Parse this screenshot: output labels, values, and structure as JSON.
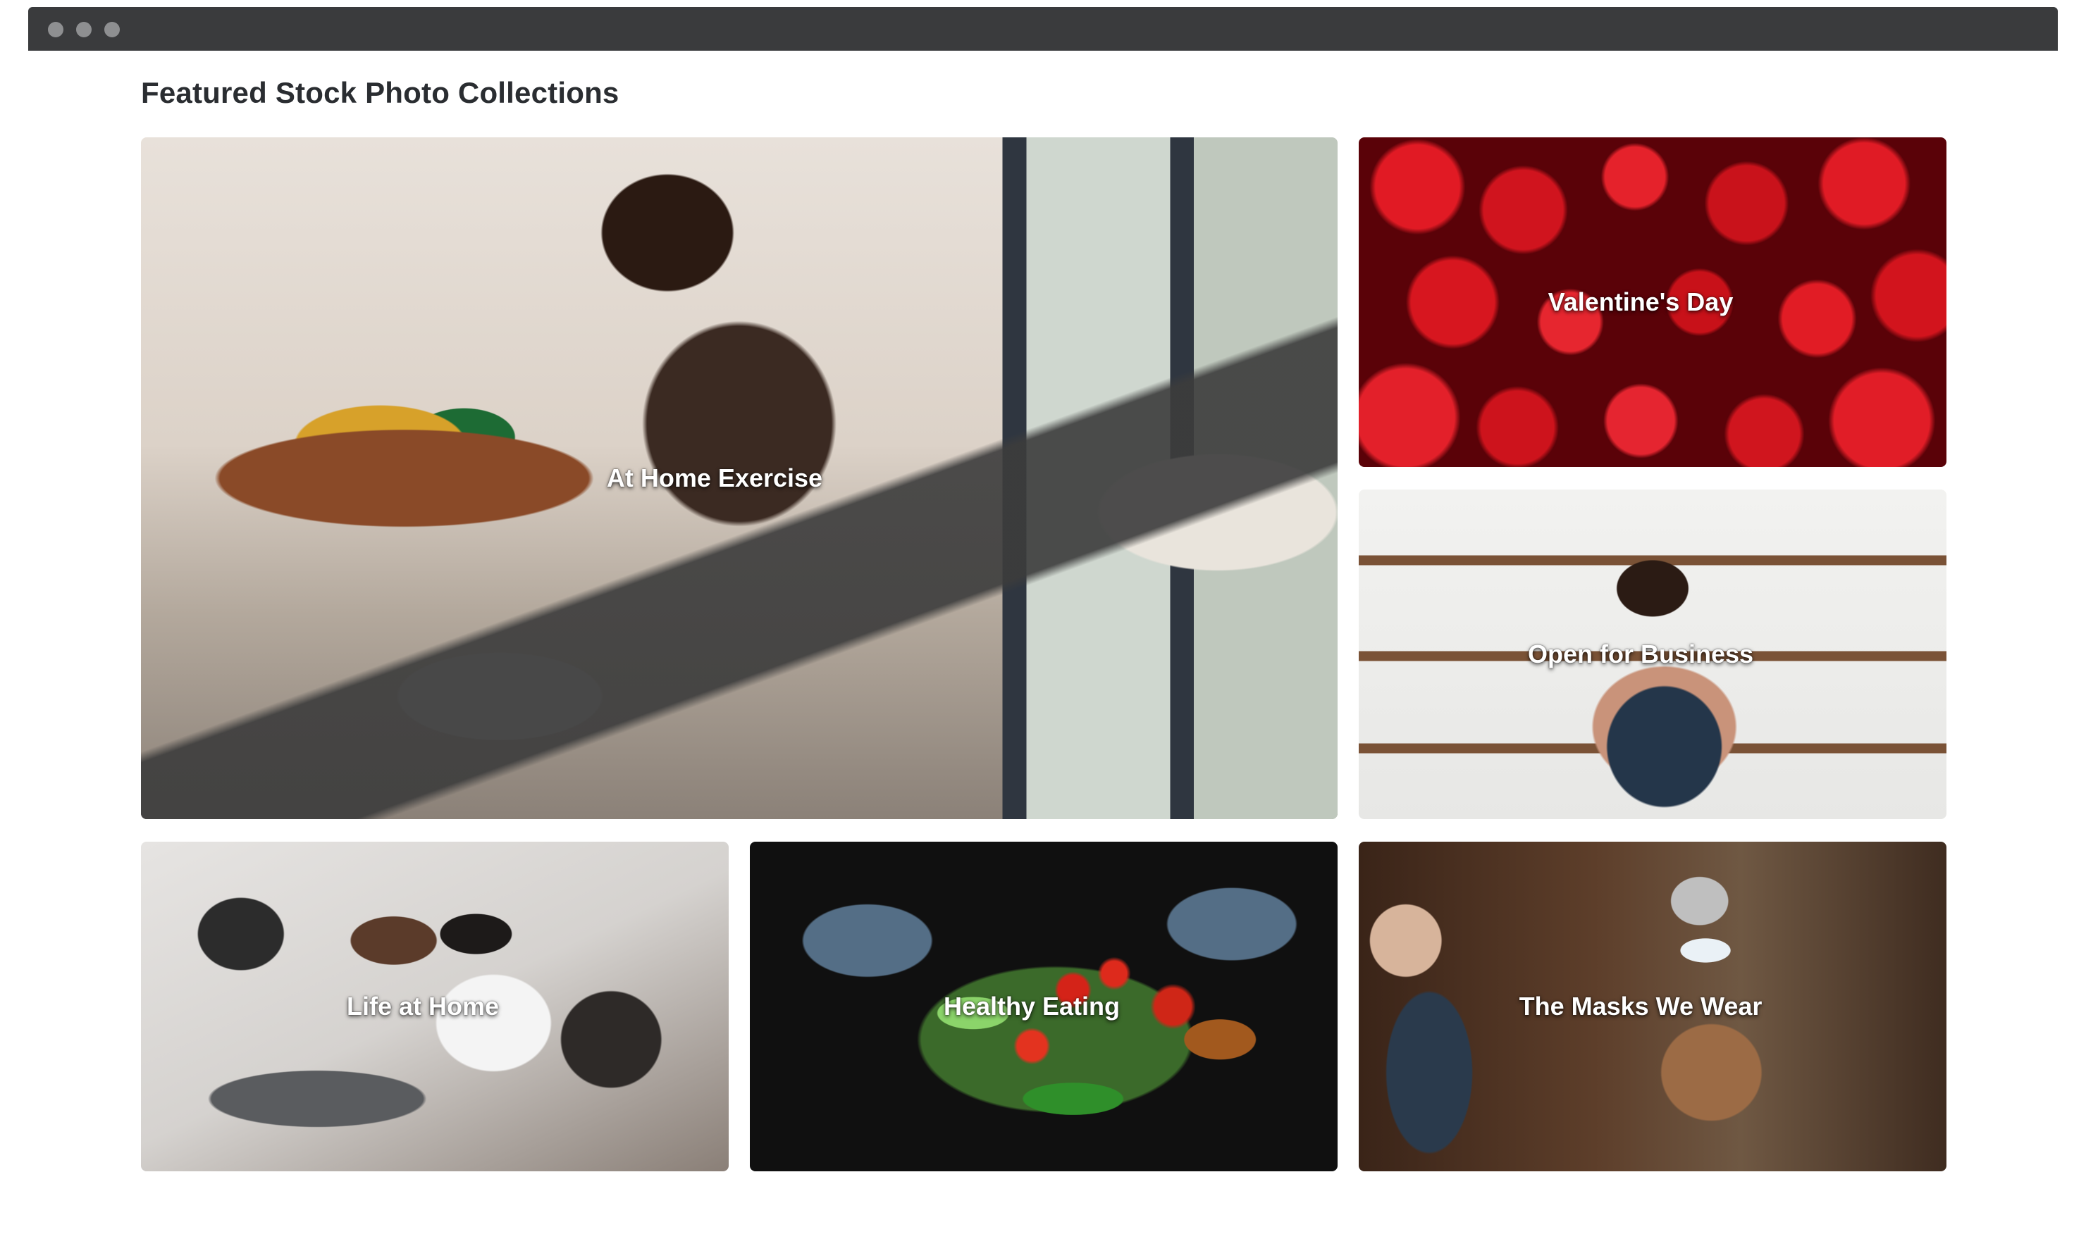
{
  "page": {
    "title": "Featured Stock Photo Collections"
  },
  "collections": [
    {
      "label": "At Home Exercise"
    },
    {
      "label": "Valentine's Day"
    },
    {
      "label": "Open for Business"
    },
    {
      "label": "Life at Home"
    },
    {
      "label": "Healthy Eating"
    },
    {
      "label": "The Masks We Wear"
    }
  ]
}
